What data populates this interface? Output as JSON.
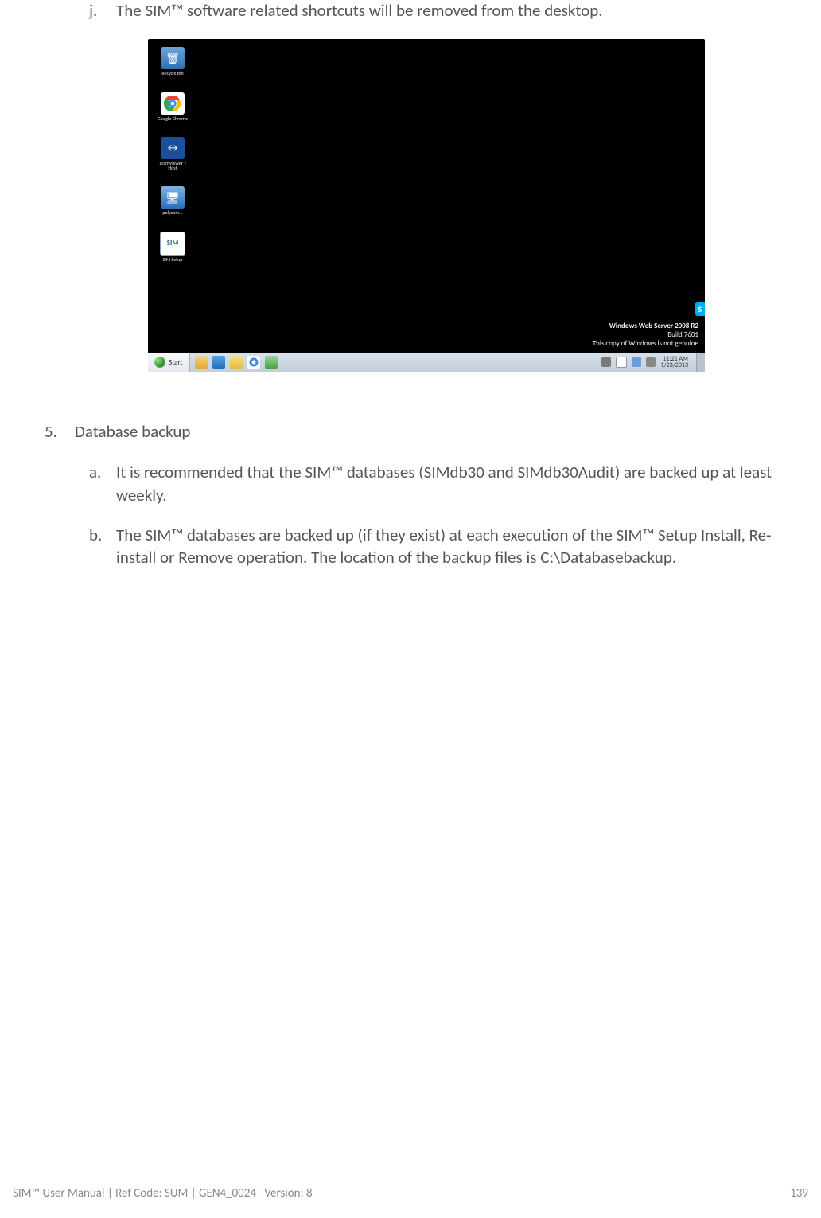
{
  "list_j": {
    "marker": "j.",
    "text": "The SIM™ software related shortcuts will be removed from the desktop."
  },
  "screenshot": {
    "desktop_icons": [
      {
        "label": "Recycle Bin",
        "color": "#2f6fb0",
        "emoji": "🗑"
      },
      {
        "label": "Google Chrome",
        "color": "#ffffff",
        "emoji": "●"
      },
      {
        "label": "TeamViewer 7 Host",
        "color": "#1b4f9c",
        "emoji": "◆"
      },
      {
        "label": "polycom...",
        "color": "#2a6fb8",
        "emoji": "🖥"
      },
      {
        "label": "SIM Setup",
        "color": "#ffffff",
        "emoji": "SIM"
      }
    ],
    "watermark": {
      "line1": "Windows Web Server 2008 R2",
      "line2": "Build 7601",
      "line3": "This copy of Windows is not genuine"
    },
    "taskbar": {
      "start_label": "Start",
      "clock_time": "11:21 AM",
      "clock_date": "1/23/2013"
    }
  },
  "section5": {
    "num": "5.",
    "title": "Database backup",
    "items": [
      {
        "marker": "a.",
        "text": "It is recommended that the SIM™ databases (SIMdb30 and SIMdb30Audit) are backed up at least weekly."
      },
      {
        "marker": "b.",
        "text": "The SIM™ databases are backed up (if they exist) at each execution of the SIM™ Setup Install, Re-install or Remove operation. The location of the backup files is C:\\Databasebackup."
      }
    ]
  },
  "footer": {
    "left": "SIM™ User Manual | Ref Code: SUM | GEN4_0024| Version: 8",
    "right": "139"
  }
}
